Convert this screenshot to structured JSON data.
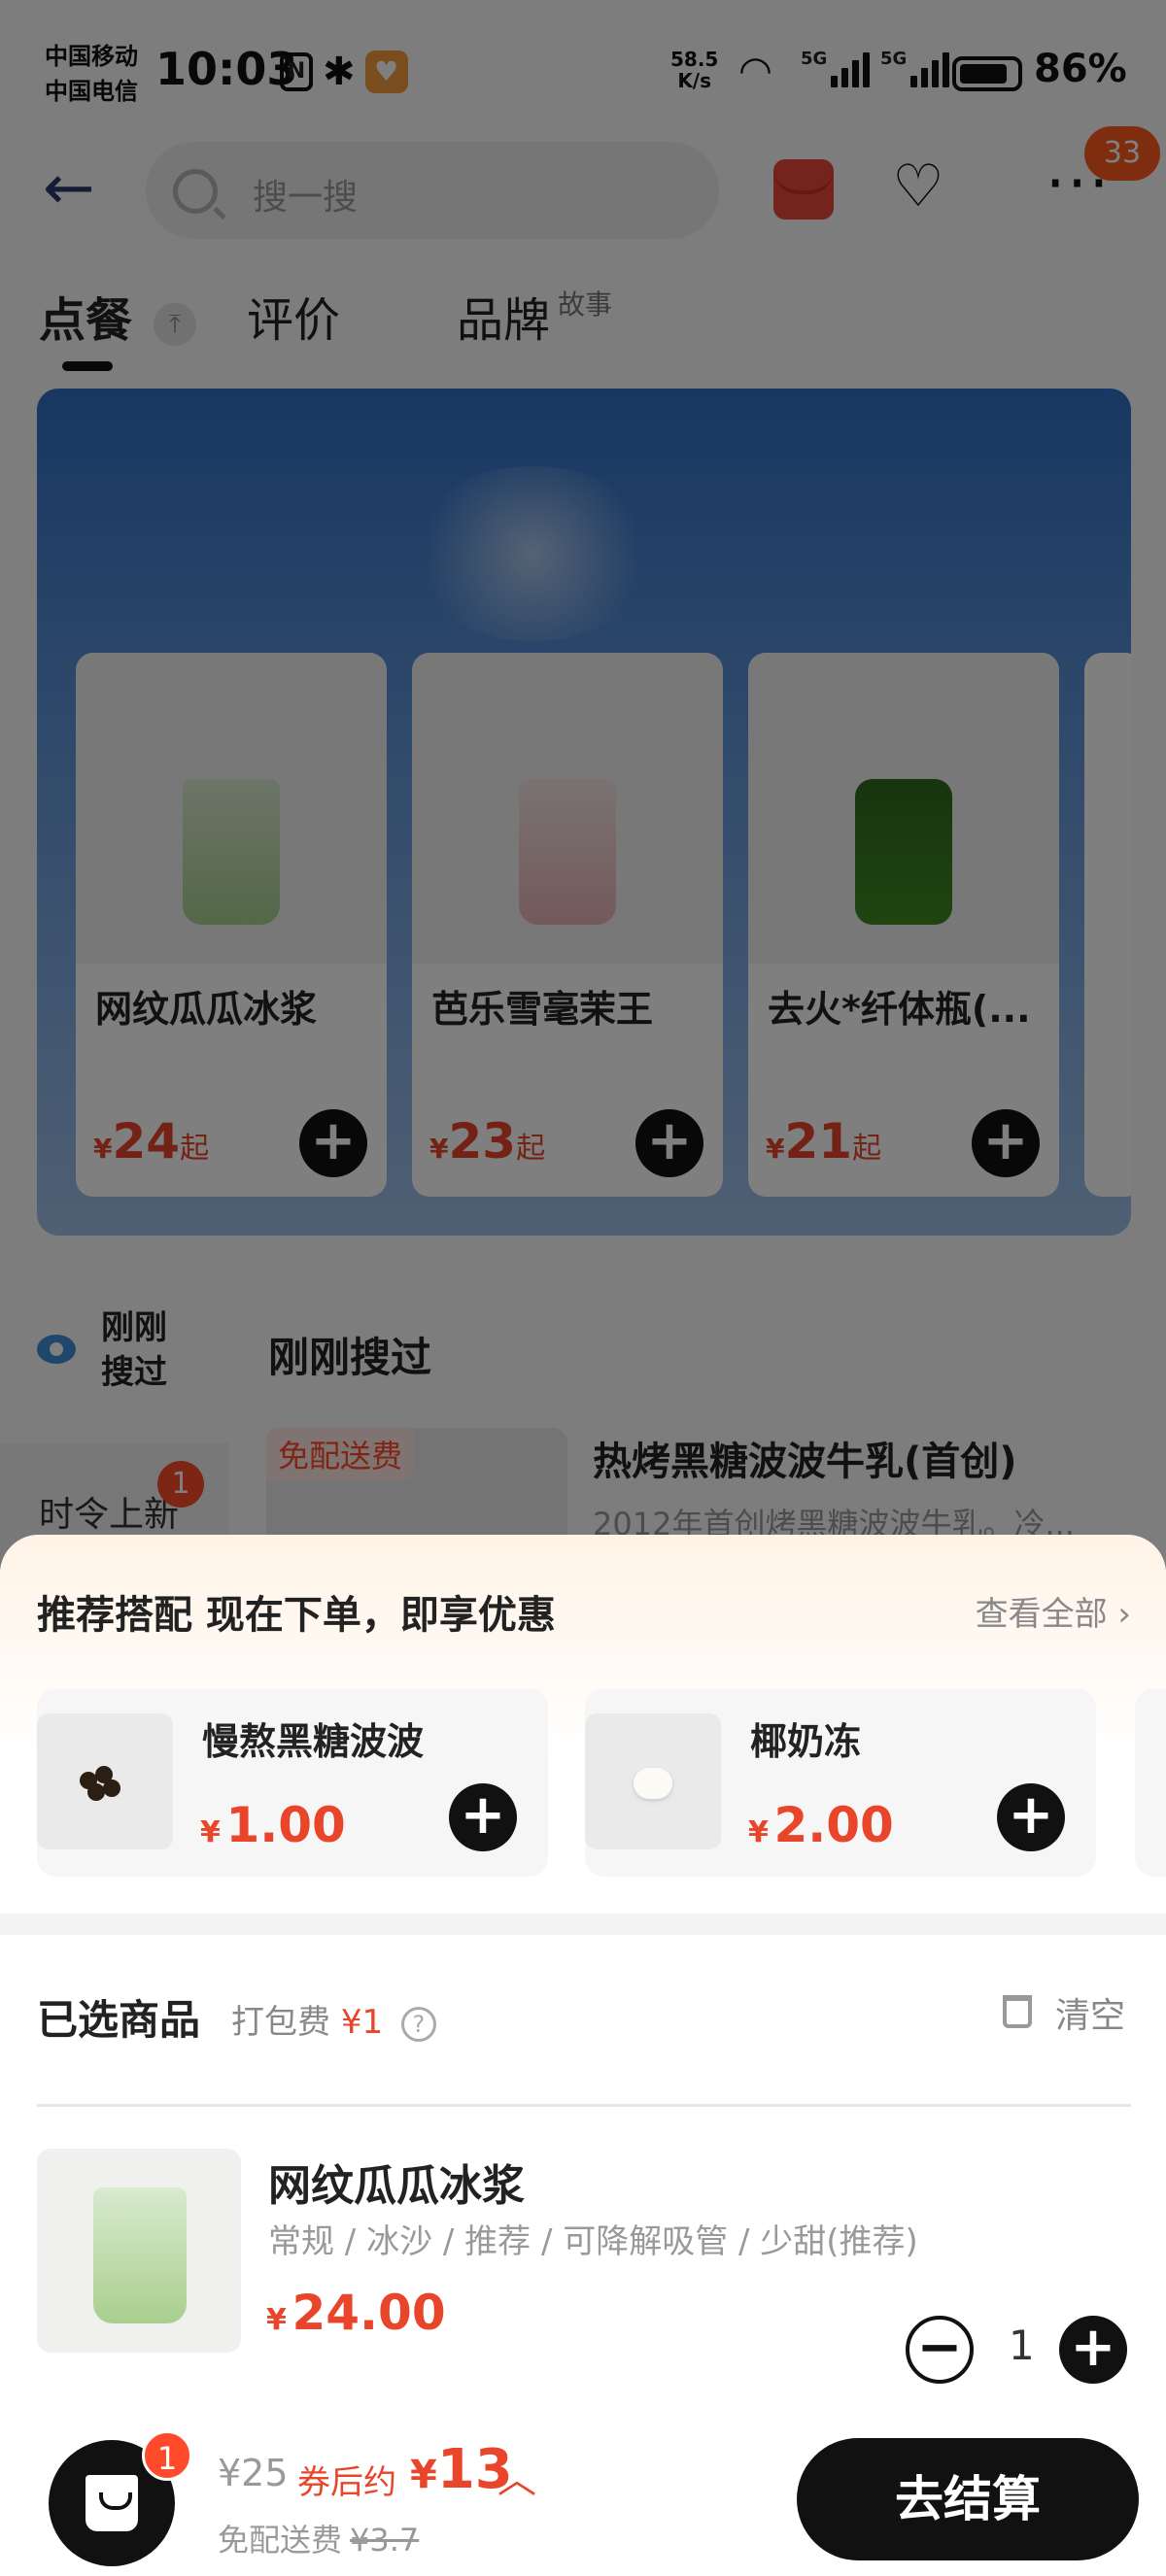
{
  "status_bar": {
    "carrier_1": "中国移动",
    "carrier_2": "中国电信",
    "time": "10:03",
    "net_speed": "58.5",
    "net_unit": "K/s",
    "sig_1": "5G",
    "sig_2": "5G",
    "battery": "86%",
    "battery_level": 0.86
  },
  "topbar": {
    "search_placeholder": "搜一搜",
    "message_badge": "33"
  },
  "tabs": {
    "order": "点餐",
    "reviews": "评价",
    "brand": "品牌",
    "brand_sup": "故事"
  },
  "banner_products": [
    {
      "name": "网纹瓜瓜冰浆",
      "currency": "¥",
      "price": "24",
      "suffix": "起"
    },
    {
      "name": "芭乐雪毫茉王",
      "currency": "¥",
      "price": "23",
      "suffix": "起"
    },
    {
      "name": "去火*纤体瓶(...",
      "currency": "¥",
      "price": "21",
      "suffix": "起"
    }
  ],
  "recent": {
    "label": "刚刚搜过",
    "title": "刚刚搜过"
  },
  "sidebar": {
    "category": "时令上新",
    "badge": "1"
  },
  "list_item": {
    "tag": "免配送费",
    "title": "热烤黑糖波波牛乳(首创)",
    "desc": "2012年首创烤黑糖波波牛乳。冷..."
  },
  "recommend": {
    "title": "推荐搭配  现在下单，即享优惠",
    "view_all": "查看全部 ›",
    "items": [
      {
        "name": "慢熬黑糖波波",
        "currency": "¥",
        "price": "1.00"
      },
      {
        "name": "椰奶冻",
        "currency": "¥",
        "price": "2.00"
      }
    ]
  },
  "selected": {
    "title": "已选商品",
    "fee_label": "打包费",
    "fee_amount": "¥1",
    "help": "?",
    "clear": "清空"
  },
  "cart_item": {
    "name": "网纹瓜瓜冰浆",
    "options": "常规 / 冰沙 / 推荐 / 可降解吸管 / 少甜(推荐)",
    "currency": "¥",
    "price": "24.00",
    "quantity": "1"
  },
  "checkout": {
    "bag_badge": "1",
    "original_price": "¥25",
    "coupon_label": "券后约",
    "final_currency": "¥",
    "final_price": "13",
    "delivery_label": "免配送费",
    "delivery_old": "¥3.7",
    "button": "去结算"
  },
  "colors": {
    "accent": "#e8452a",
    "badge": "#ff4b2b",
    "button": "#111111"
  }
}
